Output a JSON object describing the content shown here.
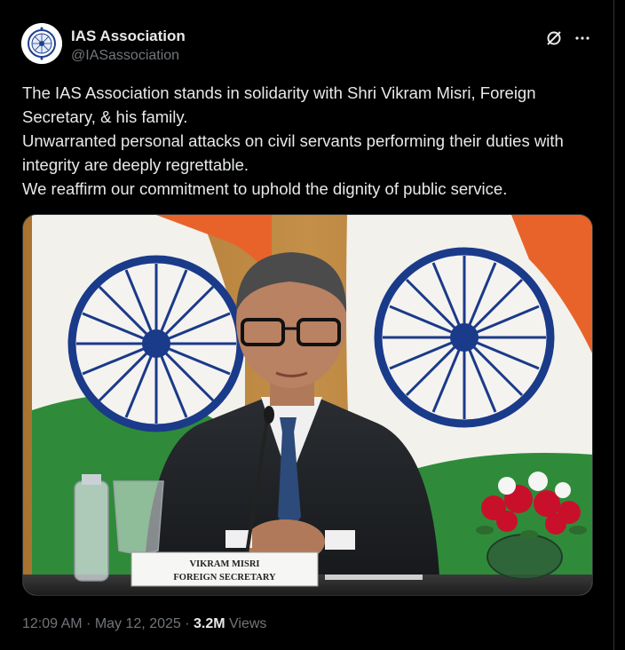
{
  "account": {
    "display_name": "IAS Association",
    "handle": "@IASassociation",
    "avatar_icon": "ias-emblem-icon"
  },
  "header_actions": [
    {
      "name": "grok-icon"
    },
    {
      "name": "more-options-icon",
      "label": "···"
    }
  ],
  "tweet": {
    "lines": [
      "The IAS Association stands in solidarity with Shri Vikram Misri, Foreign Secretary, & his family.",
      "Unwarranted personal attacks on civil servants performing their duties with integrity are deeply regrettable.",
      "We reaffirm our commitment to uphold the dignity of public service."
    ]
  },
  "media": {
    "nameplate": {
      "line1": "VIKRAM MISRI",
      "line2": "FOREIGN SECRETARY"
    }
  },
  "meta": {
    "time": "12:09 AM",
    "separator": " · ",
    "date": "May 12, 2025",
    "views_count": "3.2M",
    "views_label": "Views"
  },
  "colors": {
    "background": "#000000",
    "text_primary": "#e7e9ea",
    "text_secondary": "#71767b",
    "border": "#2f3336",
    "saffron": "#e8632a",
    "flag_green": "#2f8b3a",
    "chakra_blue": "#1a3a8a"
  }
}
